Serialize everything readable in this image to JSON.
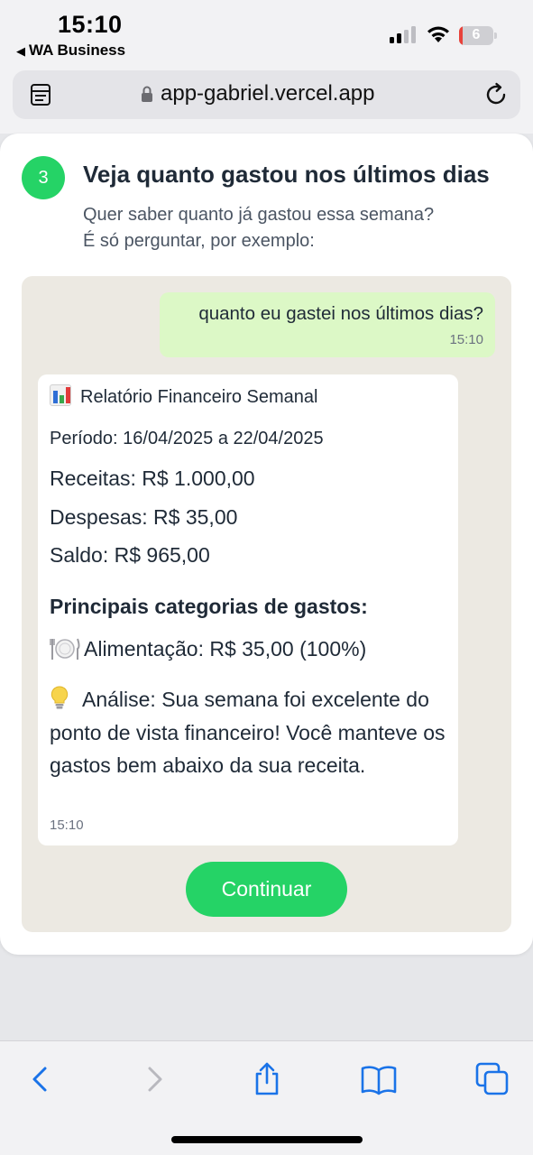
{
  "status_bar": {
    "time": "15:10",
    "back_app": "WA Business",
    "battery_level": "6",
    "battery_fraction": 0.06,
    "battery_color": "#e8423a"
  },
  "browser": {
    "url": "app-gabriel.vercel.app",
    "icons": [
      "reader-icon",
      "lock-icon",
      "reload-icon"
    ]
  },
  "step": {
    "number": "3",
    "title": "Veja quanto gastou nos últimos dias",
    "subtitle_line1": "Quer saber quanto já gastou essa semana?",
    "subtitle_line2": "É só perguntar, por exemplo:"
  },
  "chat": {
    "outgoing": {
      "text": "quanto eu gastei nos últimos dias?",
      "time": "15:10"
    },
    "incoming": {
      "title": "Relatório Financeiro Semanal",
      "period": "Período: 16/04/2025 a 22/04/2025",
      "income": "Receitas: R$ 1.000,00",
      "expenses": "Despesas: R$ 35,00",
      "balance": "Saldo: R$ 965,00",
      "categories_heading": "Principais categorias de gastos:",
      "category_food": "Alimentação: R$ 35,00 (100%)",
      "analysis": "Análise: Sua semana foi excelente do ponto de vista financeiro! Você manteve os gastos bem abaixo da sua receita.",
      "time": "15:10",
      "icons": [
        "bar-chart-icon",
        "plate-icon",
        "lightbulb-icon"
      ]
    }
  },
  "continue_label": "Continuar",
  "colors": {
    "accent": "#25d366",
    "outgoing_bubble": "#dcf8c6",
    "chat_bg": "#ece9e2"
  },
  "toolbar": {
    "icons": [
      "back-icon",
      "forward-icon",
      "share-icon",
      "bookmarks-icon",
      "tabs-icon"
    ]
  }
}
